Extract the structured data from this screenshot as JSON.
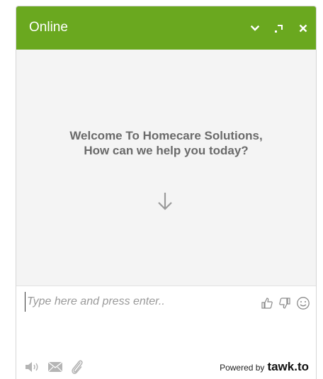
{
  "header": {
    "status_label": "Online",
    "bg_color": "#6aa81f",
    "controls": [
      {
        "name": "minimize",
        "icon": "chevron-down-icon"
      },
      {
        "name": "popout",
        "icon": "popout-icon"
      },
      {
        "name": "close",
        "icon": "close-icon"
      }
    ]
  },
  "body": {
    "welcome_message": "Welcome To Homecare Solutions, How can we help you today?",
    "arrow_icon": "arrow-down-icon",
    "bg_color": "#f4f4f4"
  },
  "composer": {
    "placeholder": "Type here and press enter..",
    "value": "",
    "rating": [
      {
        "name": "thumbs-up",
        "icon": "thumbs-up-icon"
      },
      {
        "name": "thumbs-down",
        "icon": "thumbs-down-icon"
      },
      {
        "name": "emoji",
        "icon": "smiley-icon"
      }
    ],
    "footer_icons": [
      {
        "name": "sound",
        "icon": "speaker-icon"
      },
      {
        "name": "email",
        "icon": "envelope-icon"
      },
      {
        "name": "attach",
        "icon": "paperclip-icon"
      }
    ]
  },
  "footer": {
    "powered_by_label": "Powered by",
    "brand": "tawk.to"
  }
}
